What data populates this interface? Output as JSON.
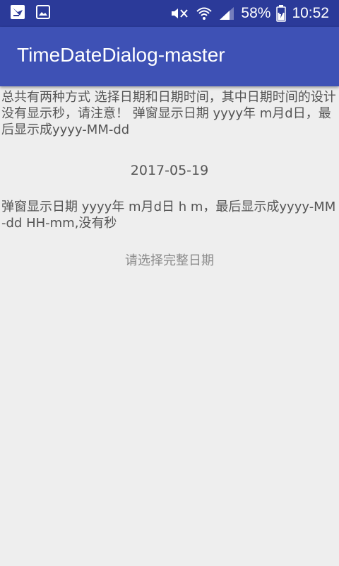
{
  "status_bar": {
    "battery": "58%",
    "time": "10:52",
    "icons": {
      "left": [
        "notification-app-icon",
        "image-icon"
      ],
      "right": [
        "vibrate-icon",
        "wifi-icon",
        "signal-icon",
        "battery-icon"
      ]
    },
    "colors": {
      "background": "#2b3a99",
      "foreground": "#ffffff"
    }
  },
  "app_bar": {
    "title": "TimeDateDialog-master",
    "color": "#3e51b5"
  },
  "content": {
    "intro_text": "总共有两种方式 选择日期和日期时间，其中日期时间的设计没有显示秒，请注意！     弹窗显示日期 yyyy年 m月d日，最后显示成yyyy-MM-dd",
    "date_value": "2017-05-19",
    "datetime_text": "弹窗显示日期 yyyy年 m月d日 h m，最后显示成yyyy-MM-dd HH-mm,没有秒",
    "datetime_hint": "请选择完整日期"
  },
  "colors": {
    "background": "#eeeeee",
    "text": "#555555",
    "hint": "#8a8a8a"
  }
}
